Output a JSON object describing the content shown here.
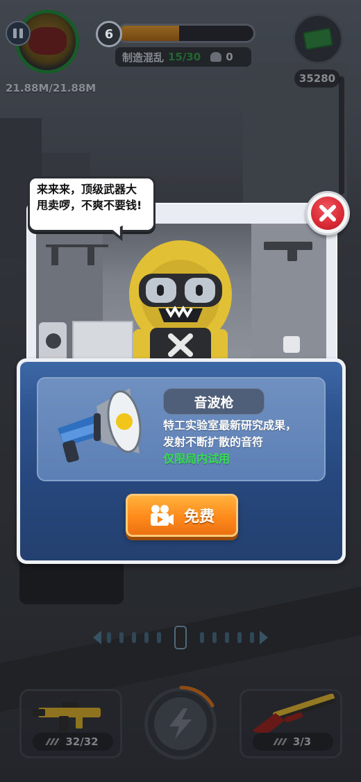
{
  "hud": {
    "hp": "21.88M/21.88M",
    "level": "6",
    "level_progress": 0.45,
    "chaos_label": "制造混乱",
    "chaos_value": "15/30",
    "kills": "0",
    "money": "35280"
  },
  "speech": {
    "text": "来来来，顶级武器大甩卖啰，不爽不要钱!"
  },
  "popup": {
    "weapon_name": "音波枪",
    "desc_line1": "特工实验室最新研究成果，",
    "desc_line2": "发射不断扩散的音符",
    "limit_note": "仅限局内试用",
    "free_label": "免费"
  },
  "weapons": {
    "left_ammo": "32/32",
    "right_ammo": "3/3"
  },
  "icons": [
    "pause-icon",
    "skull-icon",
    "money-icon",
    "close-icon",
    "megaphone-icon",
    "video-icon",
    "lightning-icon",
    "bullets-icon"
  ],
  "colors": {
    "accent_orange": "#ff8a1b",
    "limit_green": "#34e04d",
    "close_red": "#d82a35",
    "panel_blue": "#2f5590"
  }
}
